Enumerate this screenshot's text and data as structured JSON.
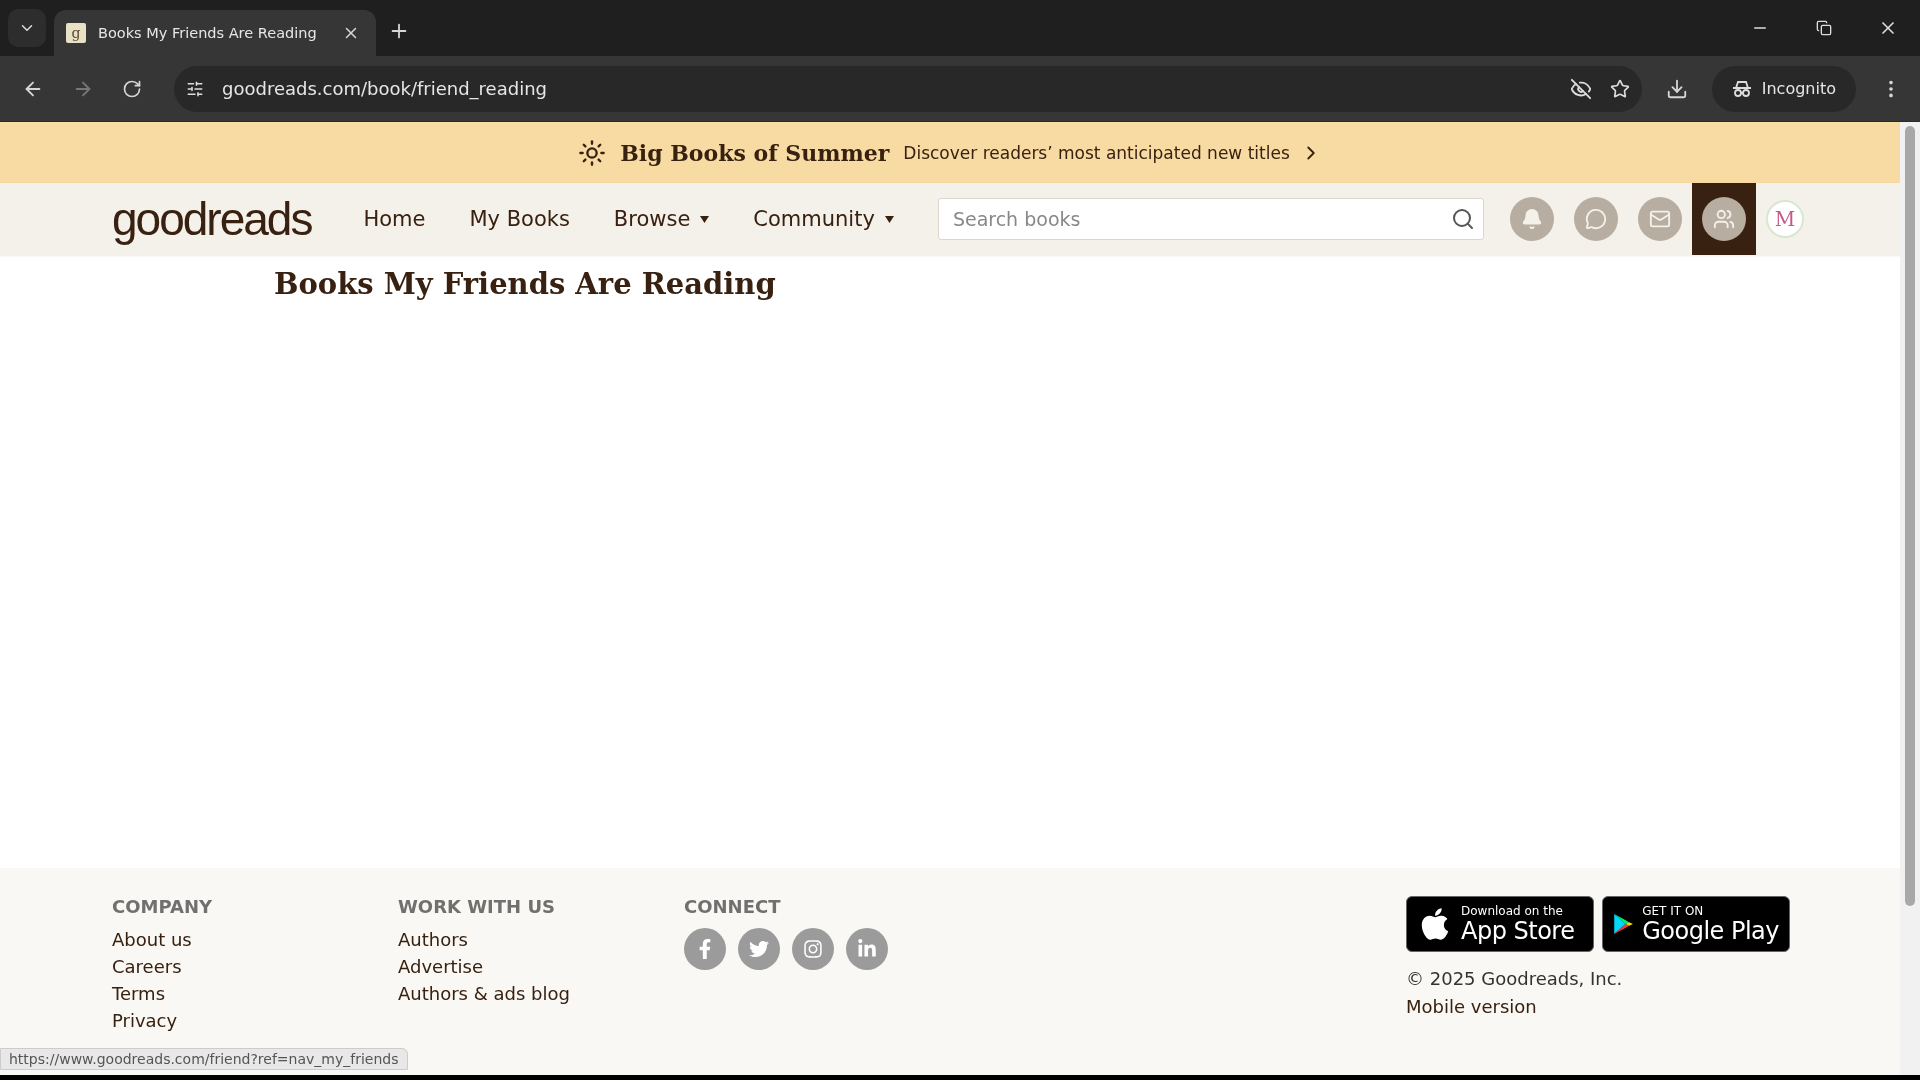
{
  "browser": {
    "tab_title": "Books My Friends Are Reading",
    "favicon": "g",
    "address": "goodreads.com/book/friend_reading",
    "profile_label": "Incognito"
  },
  "banner": {
    "title": "Big Books of Summer",
    "text": "Discover readers’ most anticipated new titles"
  },
  "nav": {
    "logo": "goodreads",
    "items": [
      {
        "label": "Home",
        "dropdown": false
      },
      {
        "label": "My Books",
        "dropdown": false
      },
      {
        "label": "Browse",
        "dropdown": true
      },
      {
        "label": "Community",
        "dropdown": true
      }
    ],
    "search": {
      "placeholder": "Search books"
    },
    "icons": [
      {
        "kind": "notifications",
        "selected": false
      },
      {
        "kind": "discussions",
        "selected": false
      },
      {
        "kind": "messages",
        "selected": false
      },
      {
        "kind": "friends",
        "selected": true
      }
    ],
    "avatar_letter": "M"
  },
  "page": {
    "title": "Books My Friends Are Reading"
  },
  "footer": {
    "columns": [
      {
        "heading": "COMPANY",
        "links": [
          "About us",
          "Careers",
          "Terms",
          "Privacy"
        ]
      },
      {
        "heading": "WORK WITH US",
        "links": [
          "Authors",
          "Advertise",
          "Authors & ads blog"
        ]
      }
    ],
    "connect": {
      "heading": "CONNECT",
      "social": [
        {
          "kind": "facebook"
        },
        {
          "kind": "twitter"
        },
        {
          "kind": "instagram"
        },
        {
          "kind": "linkedin"
        }
      ]
    },
    "badges": [
      {
        "kind": "apple",
        "small": "Download on the",
        "big": "App Store"
      },
      {
        "kind": "google",
        "small": "GET IT ON",
        "big": "Google Play"
      }
    ],
    "copyright": "© 2025 Goodreads, Inc.",
    "mobile": "Mobile version"
  },
  "status_bar": {
    "url": "https://www.goodreads.com/friend?ref=nav_my_friends"
  }
}
